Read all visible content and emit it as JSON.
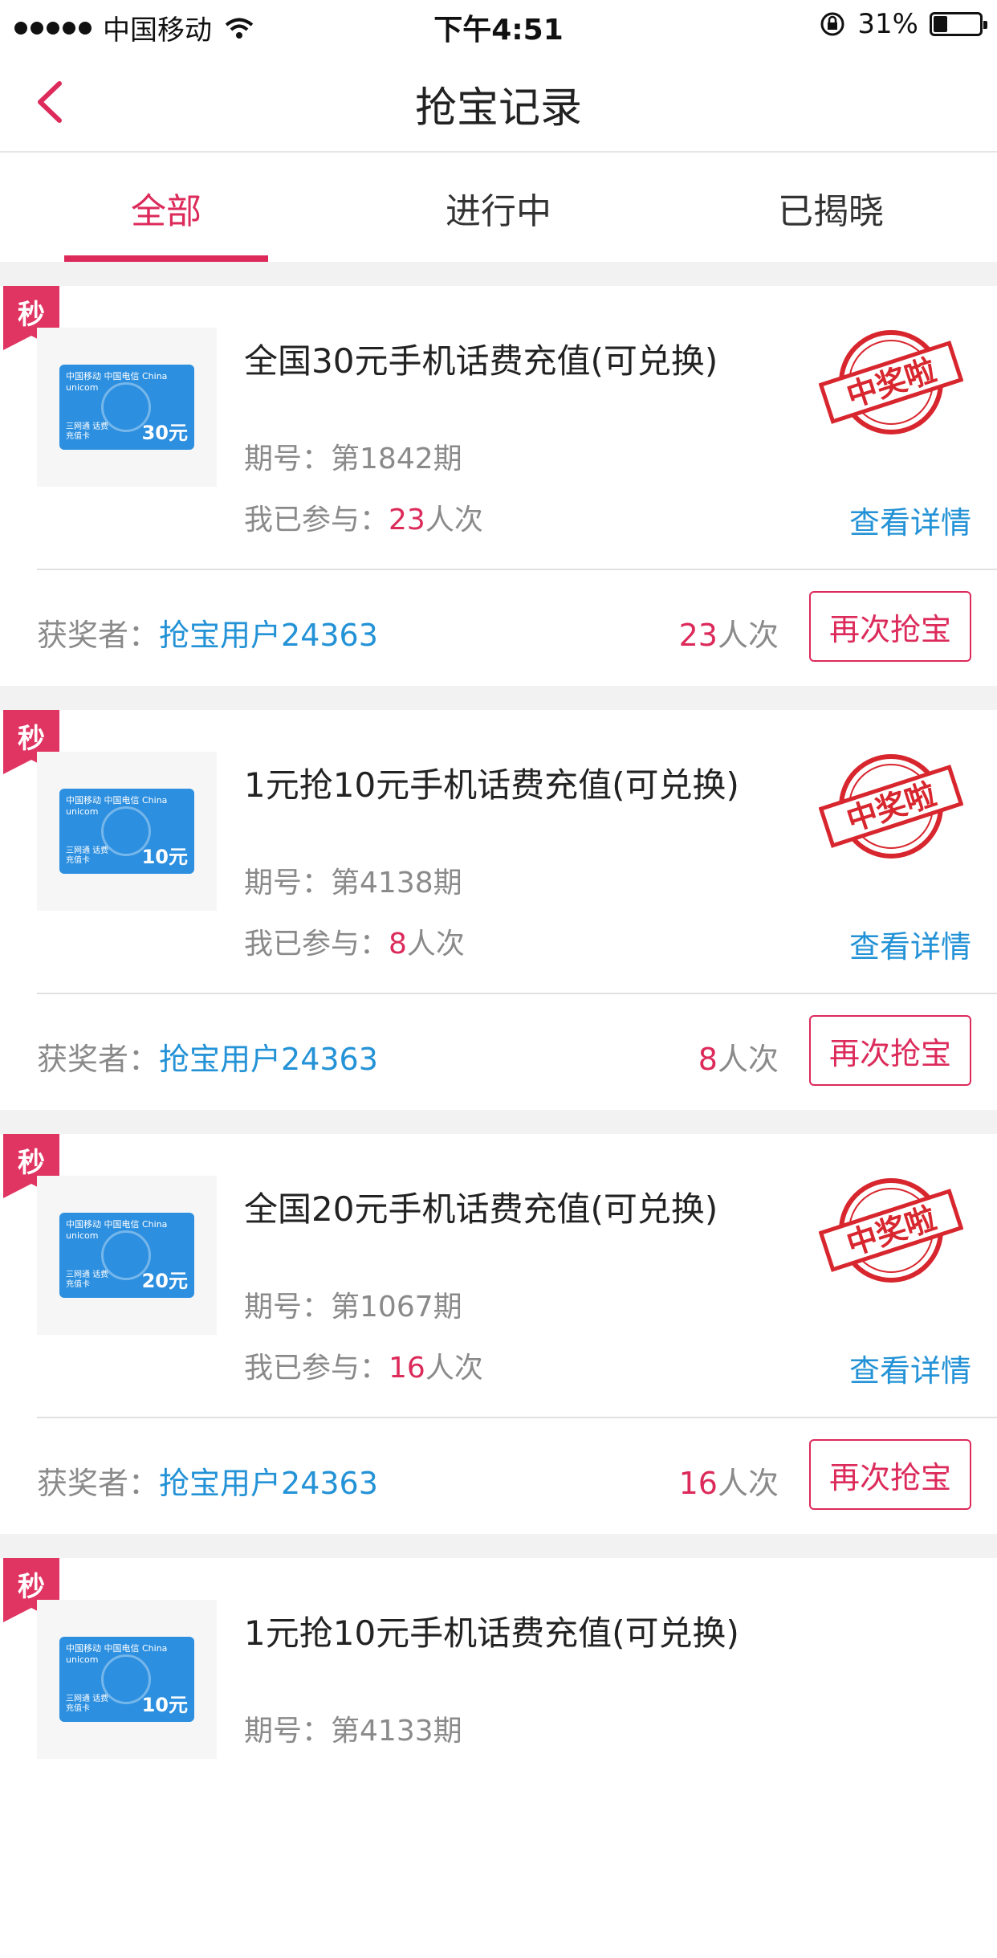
{
  "status_bar": {
    "carrier": "中国移动",
    "time": "下午4:51",
    "battery": "31%",
    "battery_level": 0.31
  },
  "nav": {
    "title": "抢宝记录"
  },
  "tabs": [
    {
      "label": "全部",
      "active": true
    },
    {
      "label": "进行中",
      "active": false
    },
    {
      "label": "已揭晓",
      "active": false
    }
  ],
  "labels": {
    "badge": "秒",
    "issue_prefix": "期号：",
    "joined_prefix": "我已参与：",
    "times_unit": "人次",
    "detail": "查看详情",
    "winner_prefix": "获奖者：",
    "again": "再次抢宝",
    "stamp_text": "中奖啦",
    "card_top": "中国移动  中国电信  China unicom",
    "card_sub": "三网通 话费充值卡"
  },
  "records": [
    {
      "title": "全国30元手机话费充值(可兑换)",
      "issue": "第1842期",
      "joined": "23",
      "winner": "抢宝用户24363",
      "winner_count": "23",
      "card_amount": "30元",
      "won": true
    },
    {
      "title": "1元抢10元手机话费充值(可兑换)",
      "issue": "第4138期",
      "joined": "8",
      "winner": "抢宝用户24363",
      "winner_count": "8",
      "card_amount": "10元",
      "won": true
    },
    {
      "title": "全国20元手机话费充值(可兑换)",
      "issue": "第1067期",
      "joined": "16",
      "winner": "抢宝用户24363",
      "winner_count": "16",
      "card_amount": "20元",
      "won": true
    },
    {
      "title": "1元抢10元手机话费充值(可兑换)",
      "issue": "第4133期",
      "joined": "",
      "winner": "",
      "winner_count": "",
      "card_amount": "10元",
      "won": false
    }
  ],
  "colors": {
    "accent": "#dc2a5a",
    "link": "#2392d6",
    "card_blue": "#2c8fe0",
    "stamp": "#d8262e"
  }
}
